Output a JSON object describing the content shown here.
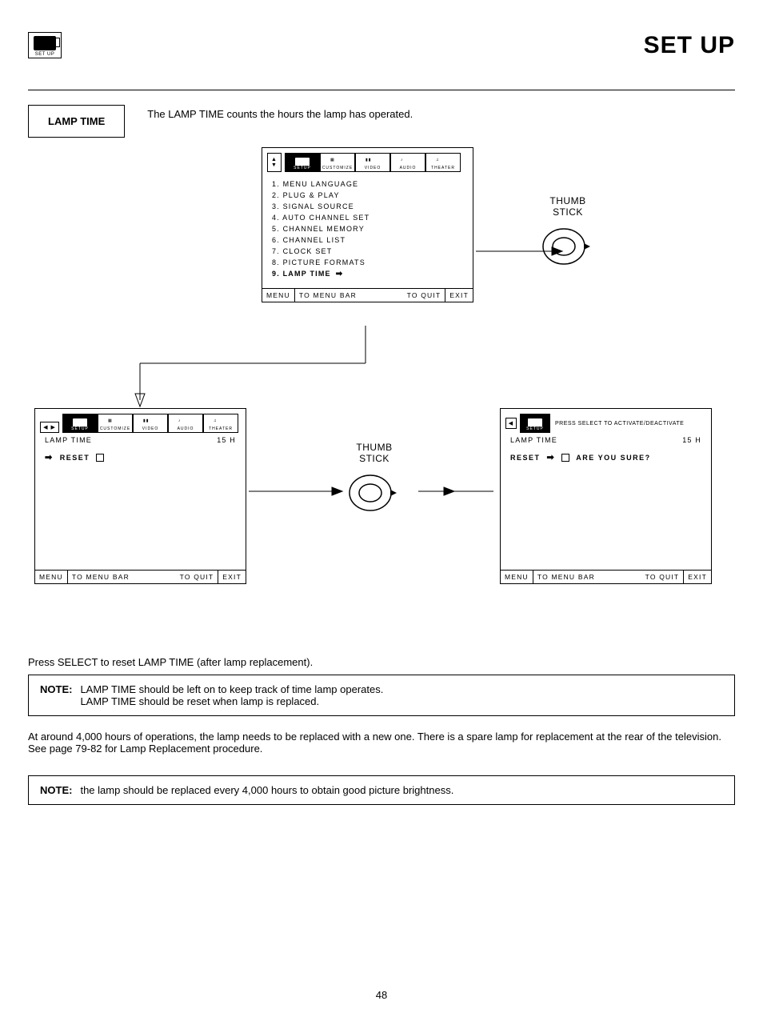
{
  "header": {
    "icon_label": "SET UP",
    "page_title": "SET UP"
  },
  "section": {
    "label": "LAMP TIME",
    "intro": "The LAMP TIME counts the hours the lamp has operated."
  },
  "tabs": {
    "setup": "SETUP",
    "customize": "CUSTOMIZE",
    "video": "VIDEO",
    "audio": "AUDIO",
    "theater": "THEATER"
  },
  "menu_top": {
    "i1": "1. MENU LANGUAGE",
    "i2": "2. PLUG & PLAY",
    "i3": "3. SIGNAL SOURCE",
    "i4": "4. AUTO CHANNEL SET",
    "i5": "5. CHANNEL MEMORY",
    "i6": "6. CHANNEL LIST",
    "i7": "7. CLOCK SET",
    "i8": "8. PICTURE FORMATS",
    "i9": "9. LAMP TIME"
  },
  "footer": {
    "menu": "MENU",
    "to_menu_bar": "TO MENU BAR",
    "to_quit": "TO QUIT",
    "exit": "EXIT"
  },
  "thumb": {
    "label1": "THUMB",
    "label2": "STICK"
  },
  "screen_bl": {
    "lamp_time": "LAMP TIME",
    "hours": "15 H",
    "reset": "RESET"
  },
  "screen_br": {
    "press_select": "PRESS SELECT TO ACTIVATE/DEACTIVATE",
    "lamp_time": "LAMP TIME",
    "hours": "15 H",
    "reset": "RESET",
    "sure": "ARE YOU SURE?"
  },
  "body": {
    "p1": "Press SELECT to reset LAMP TIME (after lamp replacement).",
    "note1_label": "NOTE:",
    "note1_l1": "LAMP TIME should be left on to keep track of time lamp operates.",
    "note1_l2": "LAMP TIME should be reset when lamp is replaced.",
    "p2": "At around 4,000 hours of operations, the lamp needs to be replaced with a new one.  There is a spare lamp for replacement at the rear of the television.  See page 79-82 for Lamp Replacement procedure.",
    "note2_label": "NOTE:",
    "note2": "the lamp should be replaced every 4,000 hours to obtain good picture brightness."
  },
  "page_number": "48"
}
